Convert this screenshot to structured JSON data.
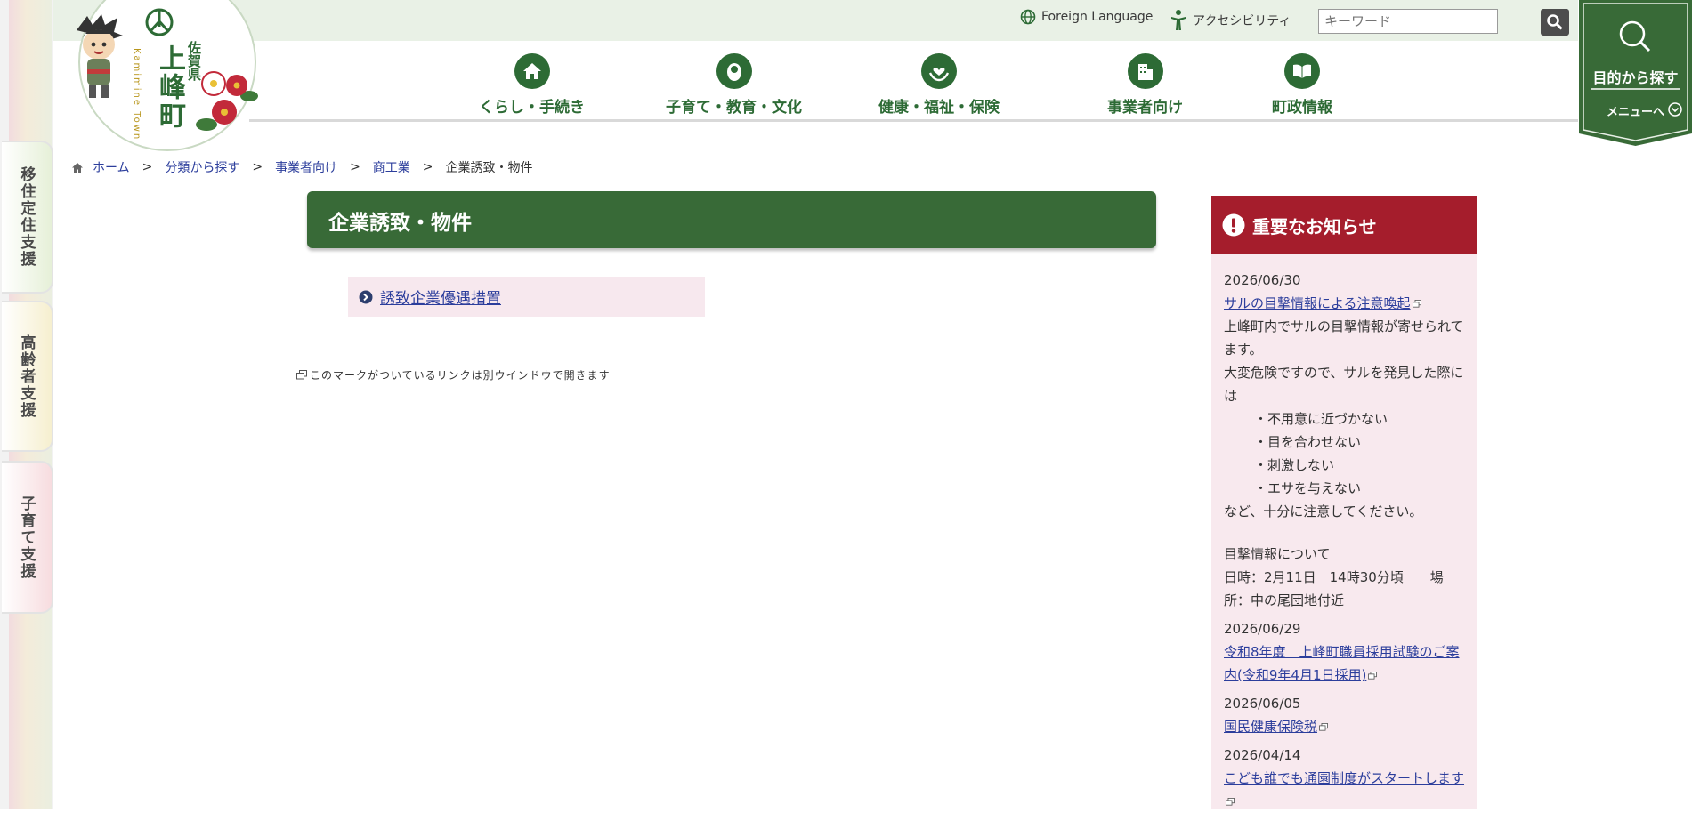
{
  "side_tabs": [
    "移住定住支援",
    "高齢者支援",
    "子育て支援"
  ],
  "logo": {
    "town_name": "上峰町",
    "prefecture": "佐賀県",
    "roman": "Kamimine Town"
  },
  "utility": {
    "foreign_language": "Foreign Language",
    "accessibility": "アクセシビリティ",
    "search_placeholder": "キーワード"
  },
  "purpose_menu": {
    "label": "目的から探す",
    "sub": "メニューへ"
  },
  "nav": [
    {
      "label": "くらし・手続き",
      "icon": "house-icon"
    },
    {
      "label": "子育て・教育・文化",
      "icon": "baby-icon"
    },
    {
      "label": "健康・福祉・保険",
      "icon": "heart-hands-icon"
    },
    {
      "label": "事業者向け",
      "icon": "building-icon"
    },
    {
      "label": "町政情報",
      "icon": "book-icon"
    }
  ],
  "breadcrumb": {
    "items": [
      "ホーム",
      "分類から探す",
      "事業者向け",
      "商工業"
    ],
    "current": "企業誘致・物件",
    "separator": ">"
  },
  "main": {
    "title": "企業誘致・物件",
    "link": "誘致企業優遇措置",
    "note": "このマークがついているリンクは別ウインドウで開きます"
  },
  "notice": {
    "heading": "重要なお知らせ",
    "items": [
      {
        "date": "2026/06/30",
        "title": "サルの目撃情報による注意喚起",
        "lines": [
          "上峰町内でサルの目撃情報が寄せられてます。",
          "大変危険ですので、サルを発見した際には"
        ],
        "bullets": [
          "・不用意に近づかない",
          "・目を合わせない",
          "・刺激しない",
          "・エサを与えない"
        ],
        "closing": "など、十分に注意してください。",
        "extra": [
          "目撃情報について",
          "日時：2月11日　14時30分頃　　場所：中の尾団地付近"
        ]
      },
      {
        "date": "2026/06/29",
        "title": "令和8年度　上峰町職員採用試験のご案内(令和9年4月1日採用)"
      },
      {
        "date": "2026/06/05",
        "title": "国民健康保険税"
      },
      {
        "date": "2026/04/14",
        "title": "こども誰でも通園制度がスタートします"
      }
    ]
  },
  "colors": {
    "green": "#386a37",
    "notice_red": "#a51d2c",
    "link": "#2c3e9c"
  }
}
